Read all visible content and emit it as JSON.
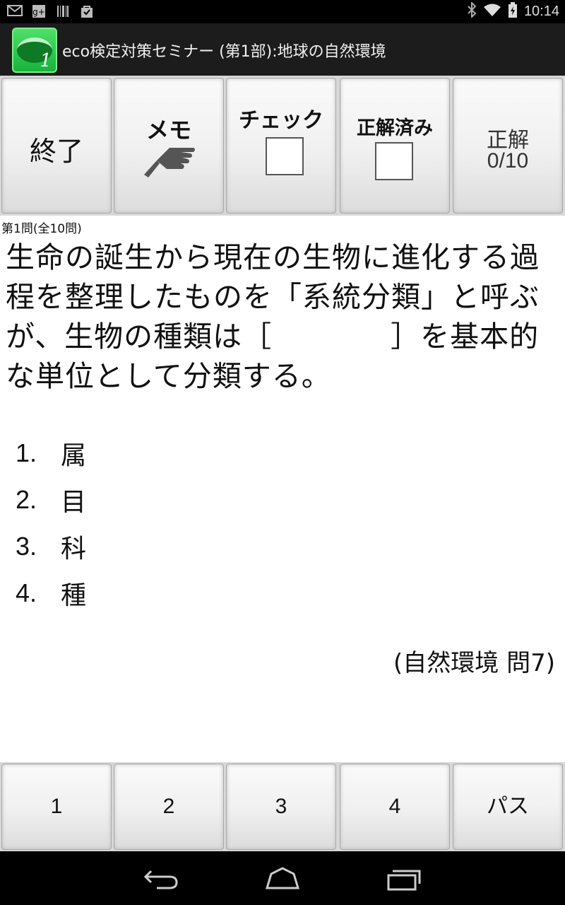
{
  "statusbar": {
    "icons_left": [
      "gmail-icon",
      "google-plus-icon",
      "barcode-icon",
      "store-bag-icon"
    ],
    "icons_right": [
      "bluetooth-icon",
      "wifi-icon",
      "battery-icon"
    ],
    "time": "10:14"
  },
  "app": {
    "icon_number": "1",
    "title": "eco検定対策セミナー (第1部):地球の自然環境"
  },
  "toolbar": {
    "end_label": "終了",
    "memo_label": "メモ",
    "check_label": "チェック",
    "answered_label": "正解済み",
    "score_label": "正解",
    "score_value": "0/10"
  },
  "question": {
    "counter": "第1問(全10問)",
    "text": "生命の誕生から現在の生物に進化する過程を整理したものを「系統分類」と呼ぶが、生物の種類は［　　　　］を基本的な単位として分類する。",
    "choices": [
      {
        "number": "1.",
        "text": "属"
      },
      {
        "number": "2.",
        "text": "目"
      },
      {
        "number": "3.",
        "text": "科"
      },
      {
        "number": "4.",
        "text": "種"
      }
    ],
    "source": "(自然環境 問7)"
  },
  "answers": {
    "buttons": [
      "1",
      "2",
      "3",
      "4",
      "パス"
    ]
  },
  "navbar": {
    "icons": [
      "back-icon",
      "home-icon",
      "recent-apps-icon"
    ]
  }
}
